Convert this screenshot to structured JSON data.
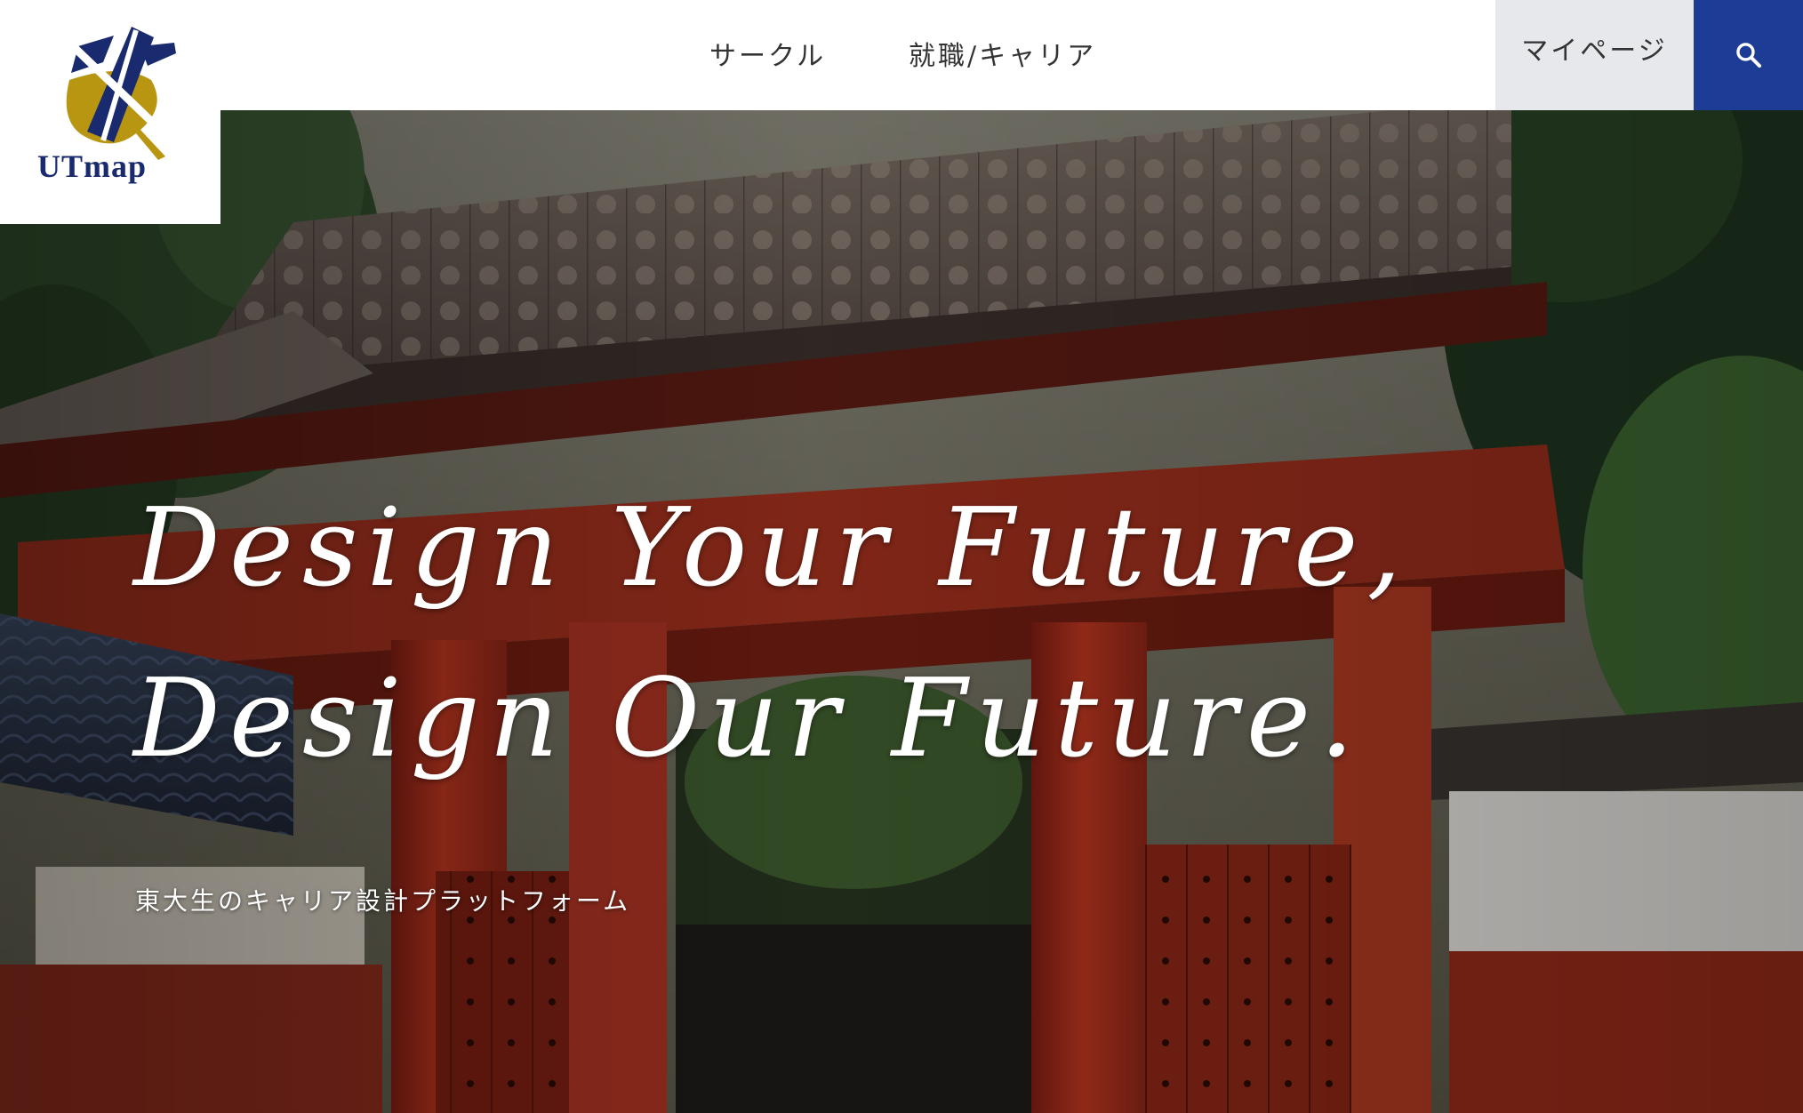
{
  "brand": {
    "name": "UTmap",
    "primary_color": "#1a2a6e",
    "accent_gold": "#b89612"
  },
  "nav": {
    "items": [
      {
        "label": "サークル"
      },
      {
        "label": "就職/キャリア"
      }
    ],
    "mypage_label": "マイページ",
    "search_icon": "search-icon",
    "search_button_color": "#1c3c96"
  },
  "hero": {
    "title_line1": "Design Your Future,",
    "title_line2": "Design Our Future.",
    "subtitle": "東大生のキャリア設計プラットフォーム",
    "background": "red-gate-photo"
  }
}
